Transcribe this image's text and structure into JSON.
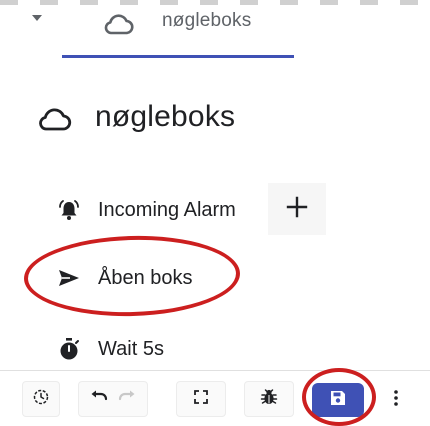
{
  "tab": {
    "label": "nøgleboks",
    "icon": "cloud-outline-icon",
    "caret_icon": "caret-down-icon"
  },
  "heading": {
    "label": "nøgleboks",
    "icon": "cloud-outline-icon"
  },
  "nodes": [
    {
      "label": "Incoming Alarm",
      "icon": "alarm-bell-icon"
    },
    {
      "label": "Åben boks",
      "icon": "send-icon"
    },
    {
      "label": "Wait 5s",
      "icon": "timer-icon"
    }
  ],
  "add_button": {
    "icon": "plus-icon"
  },
  "toolbar": {
    "history_icon": "history-icon",
    "undo_icon": "undo-icon",
    "redo_icon": "redo-icon",
    "fullscreen_icon": "fullscreen-icon",
    "debug_icon": "bug-icon",
    "save_icon": "save-icon",
    "more_icon": "more-vert-icon"
  },
  "colors": {
    "accent": "#3f51b5",
    "annotation": "#cc1f1f"
  }
}
